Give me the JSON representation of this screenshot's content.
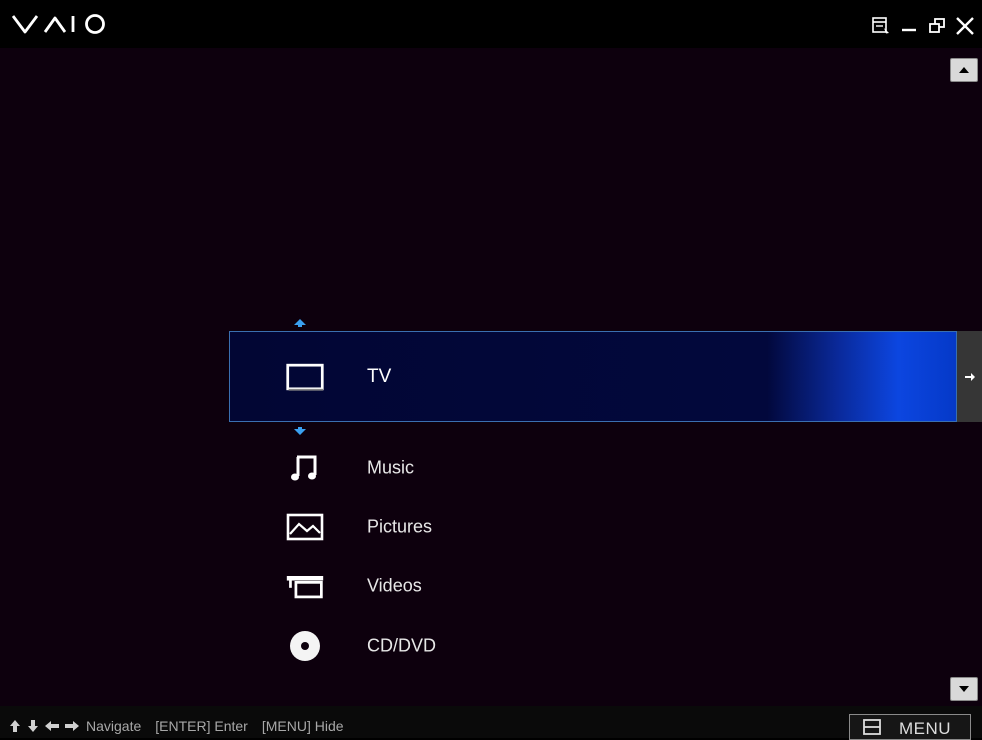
{
  "app": {
    "logo_text": "VAIO"
  },
  "window_controls": [
    "menu-view-icon",
    "minimize-icon",
    "restore-icon",
    "close-icon"
  ],
  "menu": {
    "selected_index": 0,
    "items": [
      {
        "label": "TV",
        "icon": "tv-icon"
      },
      {
        "label": "Music",
        "icon": "music-note-icon"
      },
      {
        "label": "Pictures",
        "icon": "picture-icon"
      },
      {
        "label": "Videos",
        "icon": "video-camera-icon"
      },
      {
        "label": "CD/DVD",
        "icon": "disc-icon"
      }
    ]
  },
  "footer": {
    "hint_navigate": "Navigate",
    "hint_enter": "[ENTER] Enter",
    "hint_menu": "[MENU] Hide",
    "menu_button_label": "MENU"
  },
  "colors": {
    "background": "#0d000d",
    "selected_start": "#02073a",
    "selected_end": "#0b46e0",
    "arrow_accent": "#3aa0f0"
  }
}
